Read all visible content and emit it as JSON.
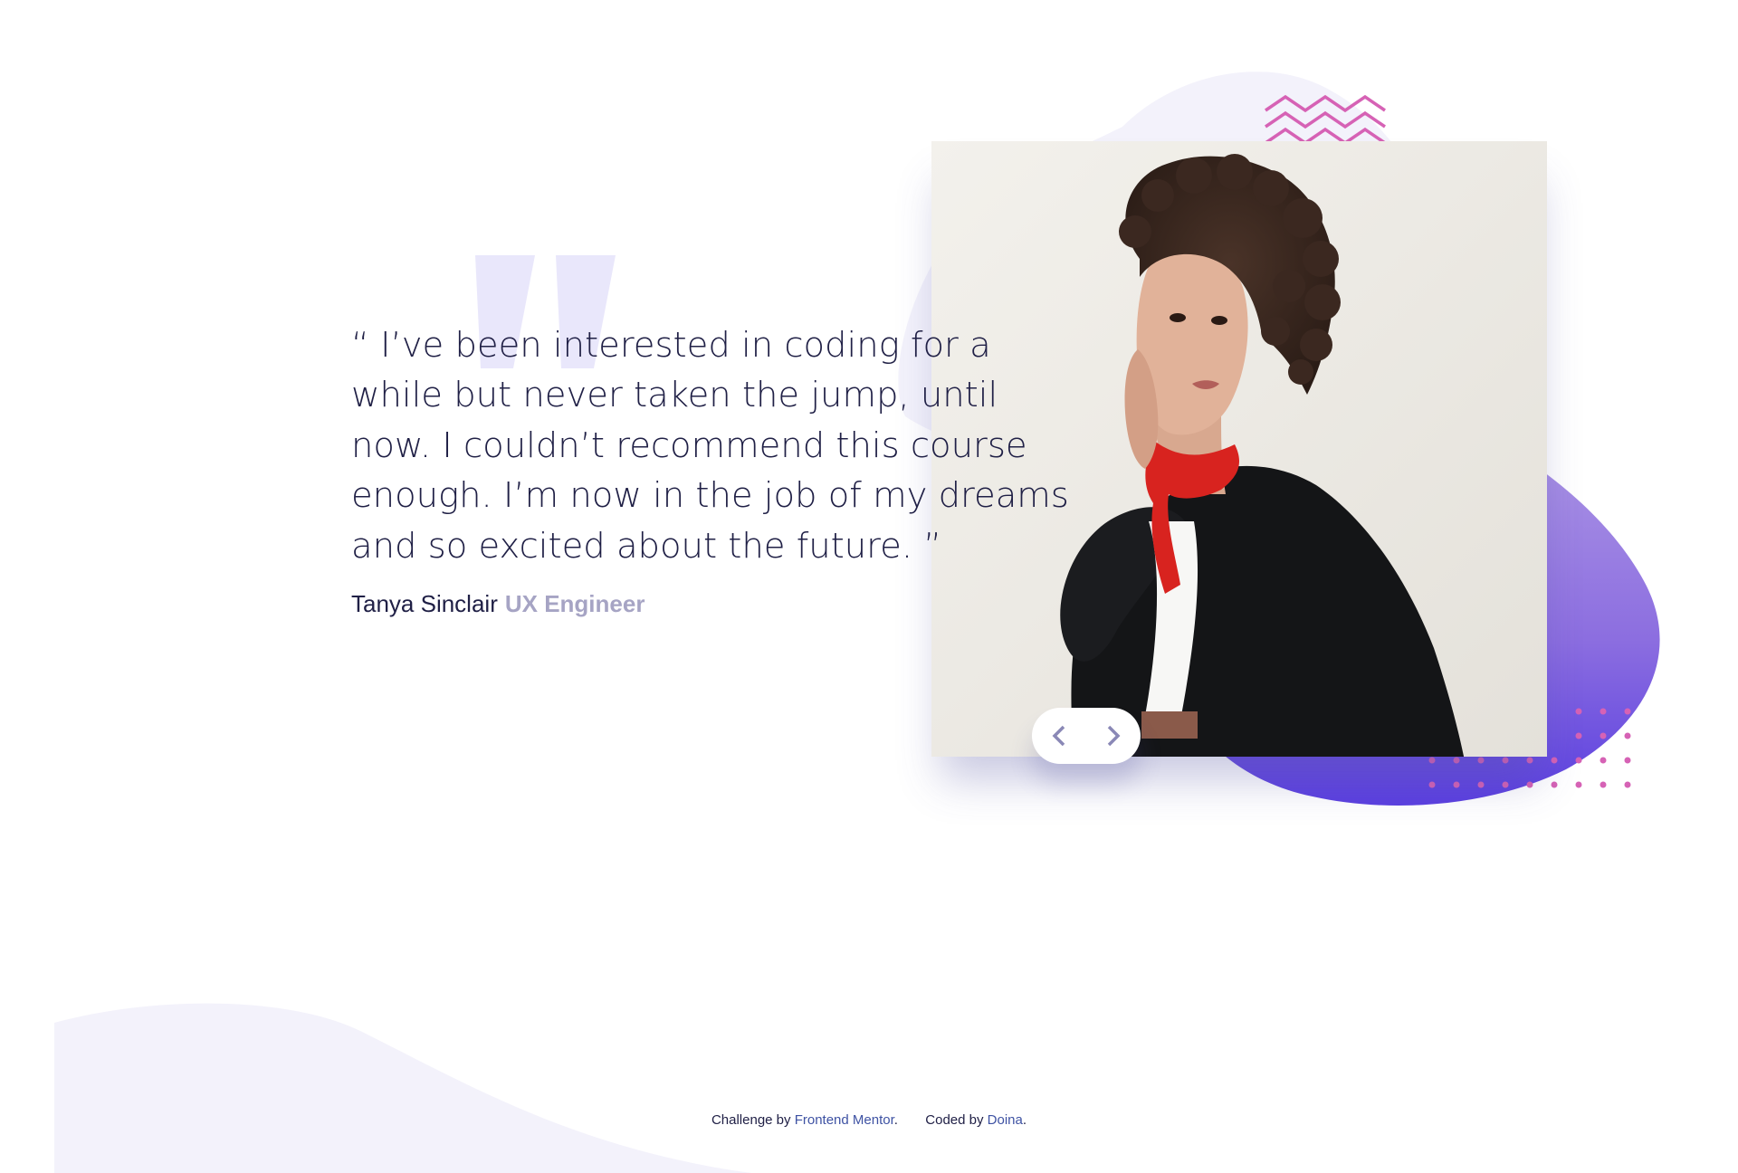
{
  "testimonial": {
    "quote": "“ I’ve been interested in coding for a while but never taken the jump, until now. I couldn’t recommend this course enough. I’m now in the job of my dreams and so excited about the future. ”",
    "author_name": "Tanya Sinclair",
    "author_role": "UX Engineer",
    "photo_icon": "portrait-photo"
  },
  "navigation": {
    "prev_icon": "chevron-left-icon",
    "next_icon": "chevron-right-icon"
  },
  "footer": {
    "challenge_prefix": "Challenge by",
    "challenge_link": "Frontend Mentor",
    "challenge_suffix": ".",
    "coded_prefix": "Coded by",
    "coded_link": "Doina",
    "coded_suffix": "."
  },
  "colors": {
    "text_dark": "#202046",
    "text_muted": "#a6a4c4",
    "link": "#3e52a3",
    "blob_purple": "#6d48e0",
    "pattern_pink": "#d662b5",
    "bg_tint": "#f3f2fb"
  }
}
